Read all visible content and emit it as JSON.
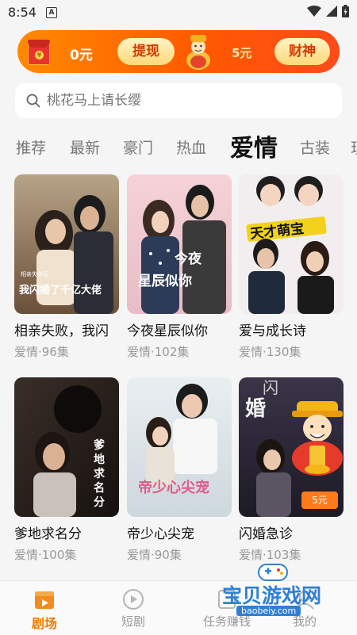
{
  "status": {
    "time": "8:54",
    "notif_glyph": "A"
  },
  "banner": {
    "balance": "0元",
    "withdraw_label": "提现",
    "coin_reward": "5元",
    "caishen_label": "财神",
    "envelope_glyph": "¥"
  },
  "search": {
    "placeholder": "桃花马上请长缨"
  },
  "tabs": [
    {
      "label": "推荐"
    },
    {
      "label": "最新"
    },
    {
      "label": "豪门"
    },
    {
      "label": "热血"
    },
    {
      "label": "爱情"
    },
    {
      "label": "古装"
    },
    {
      "label": "现"
    }
  ],
  "active_tab": "爱情",
  "dramas": [
    {
      "title": "相亲失败，我闪",
      "meta": "爱情·96集",
      "poster_text": "我闪婚了千亿大佬",
      "poster_sub": "相亲失败后"
    },
    {
      "title": "今夜星辰似你",
      "meta": "爱情·102集",
      "poster_text": "今夜星辰似你"
    },
    {
      "title": "爱与成长诗",
      "meta": "爱情·130集",
      "poster_text": "天才萌宝"
    },
    {
      "title": "爹地求名分",
      "meta": "爱情·100集",
      "poster_text": "爹地求名分"
    },
    {
      "title": "帝少心尖宠",
      "meta": "爱情·90集",
      "poster_text": "帝少心尖宠"
    },
    {
      "title": "闪婚急诊",
      "meta": "爱情·103集",
      "poster_text": "闪婚急诊"
    }
  ],
  "floating": {
    "tag": "5元"
  },
  "nav": [
    {
      "label": "剧场",
      "icon": "theater-icon",
      "active": true
    },
    {
      "label": "短剧",
      "icon": "play-icon"
    },
    {
      "label": "任务赚钱",
      "icon": "task-icon"
    },
    {
      "label": "我的",
      "icon": "profile-icon"
    }
  ],
  "watermark": {
    "text": "宝贝游戏网",
    "url": "baobeiy.com"
  },
  "colors": {
    "accent": "#f07a00",
    "banner_start": "#ff8a00",
    "banner_end": "#ff4a1a"
  }
}
